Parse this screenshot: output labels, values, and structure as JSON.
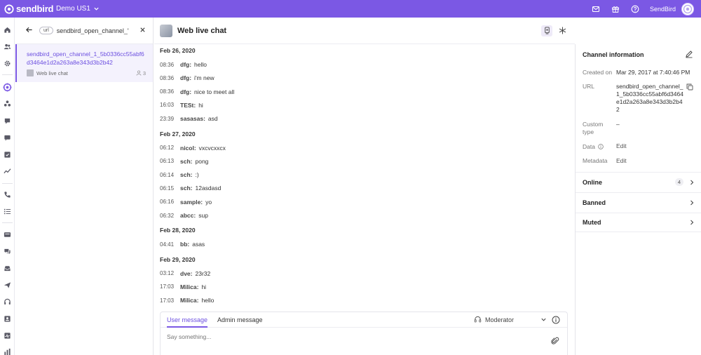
{
  "topbar": {
    "brand": "sendbird",
    "app_name": "Demo US1",
    "org_name": "SendBird",
    "bg_color": "#7b58e4",
    "icons": [
      "mail-icon",
      "gift-icon",
      "help-icon"
    ]
  },
  "nav": {
    "icons": [
      "home-icon",
      "users-icon",
      "settings-icon",
      "open-channels-icon",
      "group-channels-icon",
      "announcements-icon",
      "messages-icon",
      "moderation-icon",
      "analytics-icon",
      "calls-icon",
      "call-logs-icon",
      "desk-icon",
      "tickets-icon",
      "inbox-icon",
      "send-icon",
      "support-icon",
      "contacts-icon",
      "monitor-icon",
      "reports-icon"
    ]
  },
  "channel_list": {
    "filter_badge": "url",
    "search_value": "sendbird_open_channel_'",
    "items": [
      {
        "url": "sendbird_open_channel_1_5b0336cc55abf6d3464e1d2a263a8e343d3b2b42",
        "name": "Web live chat",
        "participants": "3"
      }
    ]
  },
  "chat": {
    "title": "Web live chat",
    "days": [
      {
        "date": "Feb 26, 2020",
        "messages": [
          {
            "time": "08:36",
            "user": "dfg:",
            "text": "hello"
          },
          {
            "time": "08:36",
            "user": "dfg:",
            "text": "i'm new"
          },
          {
            "time": "08:36",
            "user": "dfg:",
            "text": "nice to meet all"
          },
          {
            "time": "16:03",
            "user": "TESt:",
            "text": "hi"
          },
          {
            "time": "23:39",
            "user": "sasasas:",
            "text": "asd"
          }
        ]
      },
      {
        "date": "Feb 27, 2020",
        "messages": [
          {
            "time": "06:12",
            "user": "nicol:",
            "text": "vxcvcxxcx"
          },
          {
            "time": "06:13",
            "user": "sch:",
            "text": "pong"
          },
          {
            "time": "06:14",
            "user": "sch:",
            "text": ":)"
          },
          {
            "time": "06:15",
            "user": "sch:",
            "text": "12asdasd"
          },
          {
            "time": "06:16",
            "user": "sample:",
            "text": "yo"
          },
          {
            "time": "06:32",
            "user": "abcc:",
            "text": "sup"
          }
        ]
      },
      {
        "date": "Feb 28, 2020",
        "messages": [
          {
            "time": "04:41",
            "user": "bb:",
            "text": "asas"
          }
        ]
      },
      {
        "date": "Feb 29, 2020",
        "messages": [
          {
            "time": "03:12",
            "user": "dve:",
            "text": "23r32"
          },
          {
            "time": "17:03",
            "user": "Milica:",
            "text": "hi"
          },
          {
            "time": "17:03",
            "user": "Milica:",
            "text": "hello"
          }
        ]
      }
    ],
    "composer": {
      "tabs": [
        "User message",
        "Admin message"
      ],
      "active_tab": "User message",
      "sender": "Moderator",
      "placeholder": "Say something..."
    }
  },
  "info": {
    "title": "Channel information",
    "created_label": "Created on",
    "created_value": "Mar 29, 2017 at 7:40:46 PM",
    "url_label": "URL",
    "url_value": "sendbird_open_channel_1_5b0336cc55abf6d3464e1d2a263a8e343d3b2b42",
    "custom_type_label": "Custom type",
    "custom_type_value": "–",
    "data_label": "Data",
    "data_value": "Edit",
    "metadata_label": "Metadata",
    "metadata_value": "Edit",
    "sections": [
      {
        "label": "Online",
        "count": "4"
      },
      {
        "label": "Banned",
        "count": ""
      },
      {
        "label": "Muted",
        "count": ""
      }
    ]
  }
}
